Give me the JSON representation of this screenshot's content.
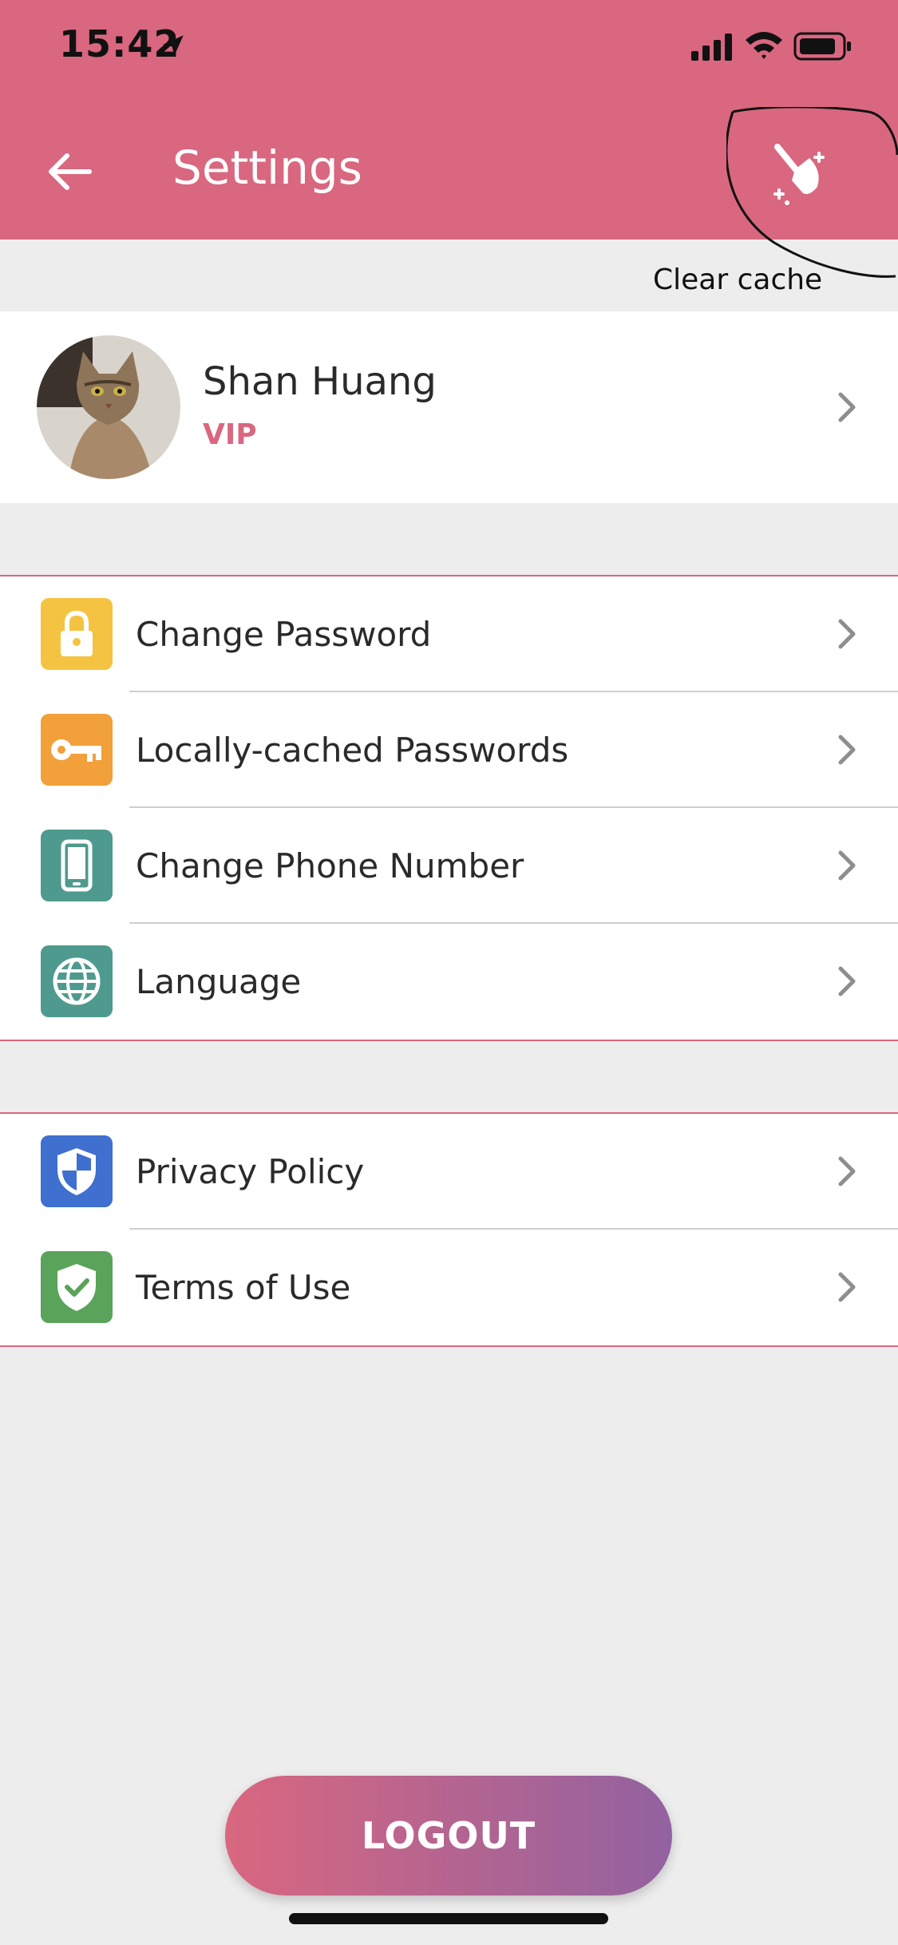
{
  "status_bar": {
    "time": "15:42"
  },
  "header": {
    "title": "Settings",
    "clear_cache_label": "Clear cache"
  },
  "profile": {
    "name": "Shan Huang",
    "tier": "VIP"
  },
  "group1": [
    {
      "label": "Change Password",
      "icon": "lock-icon",
      "color": "#f5c342"
    },
    {
      "label": "Locally-cached Passwords",
      "icon": "key-icon",
      "color": "#f1a03a"
    },
    {
      "label": "Change Phone Number",
      "icon": "phone-icon",
      "color": "#4f9a8e"
    },
    {
      "label": "Language",
      "icon": "globe-icon",
      "color": "#4f9a8e"
    }
  ],
  "group2": [
    {
      "label": "Privacy Policy",
      "icon": "shield-icon",
      "color": "#3f6fcf"
    },
    {
      "label": "Terms of Use",
      "icon": "shield-check-icon",
      "color": "#5aa35a"
    }
  ],
  "logout_label": "LOGOUT",
  "colors": {
    "accent": "#d9677f",
    "background": "#ededed",
    "gradient_end": "#9262a0"
  }
}
